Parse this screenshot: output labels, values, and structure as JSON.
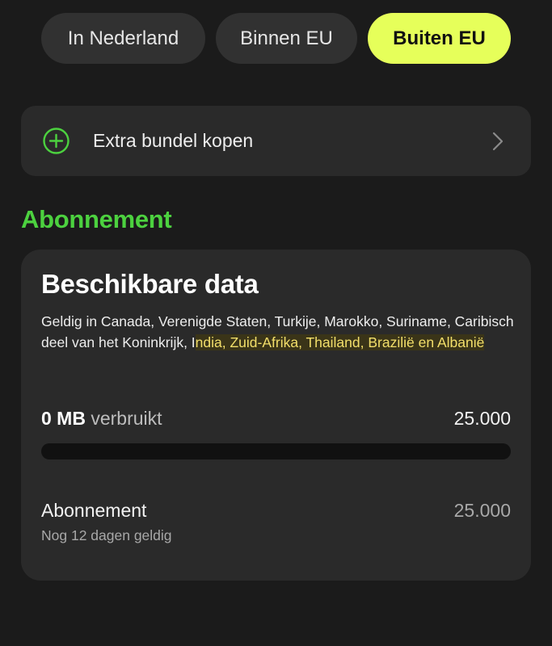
{
  "tabs": [
    {
      "label": "In Nederland",
      "active": false
    },
    {
      "label": "Binnen EU",
      "active": false
    },
    {
      "label": "Buiten EU",
      "active": true
    }
  ],
  "bundle": {
    "label": "Extra bundel kopen",
    "icon": "plus-circle-icon",
    "chevron": "chevron-right-icon"
  },
  "section": {
    "title": "Abonnement"
  },
  "card": {
    "title": "Beschikbare data",
    "valid_prefix": "Geldig in Canada, Verenigde Staten, Turkije, Marokko, Suriname, Caribisch deel van het Koninkrijk, I",
    "valid_highlight": "ndia, Zuid-Afrika, Thailand, Brazilië en Albanië",
    "used_amount": "0 MB",
    "used_word": "verbruikt",
    "total": "25.000",
    "progress_fraction": 0.0,
    "subscription_name": "Abonnement",
    "subscription_value": "25.000",
    "days_left": "Nog 12 dagen geldig"
  },
  "colors": {
    "background": "#1b1b1b",
    "accent": "#e6ff5a",
    "green": "#4cd13f",
    "highlight": "#f3df6a"
  }
}
